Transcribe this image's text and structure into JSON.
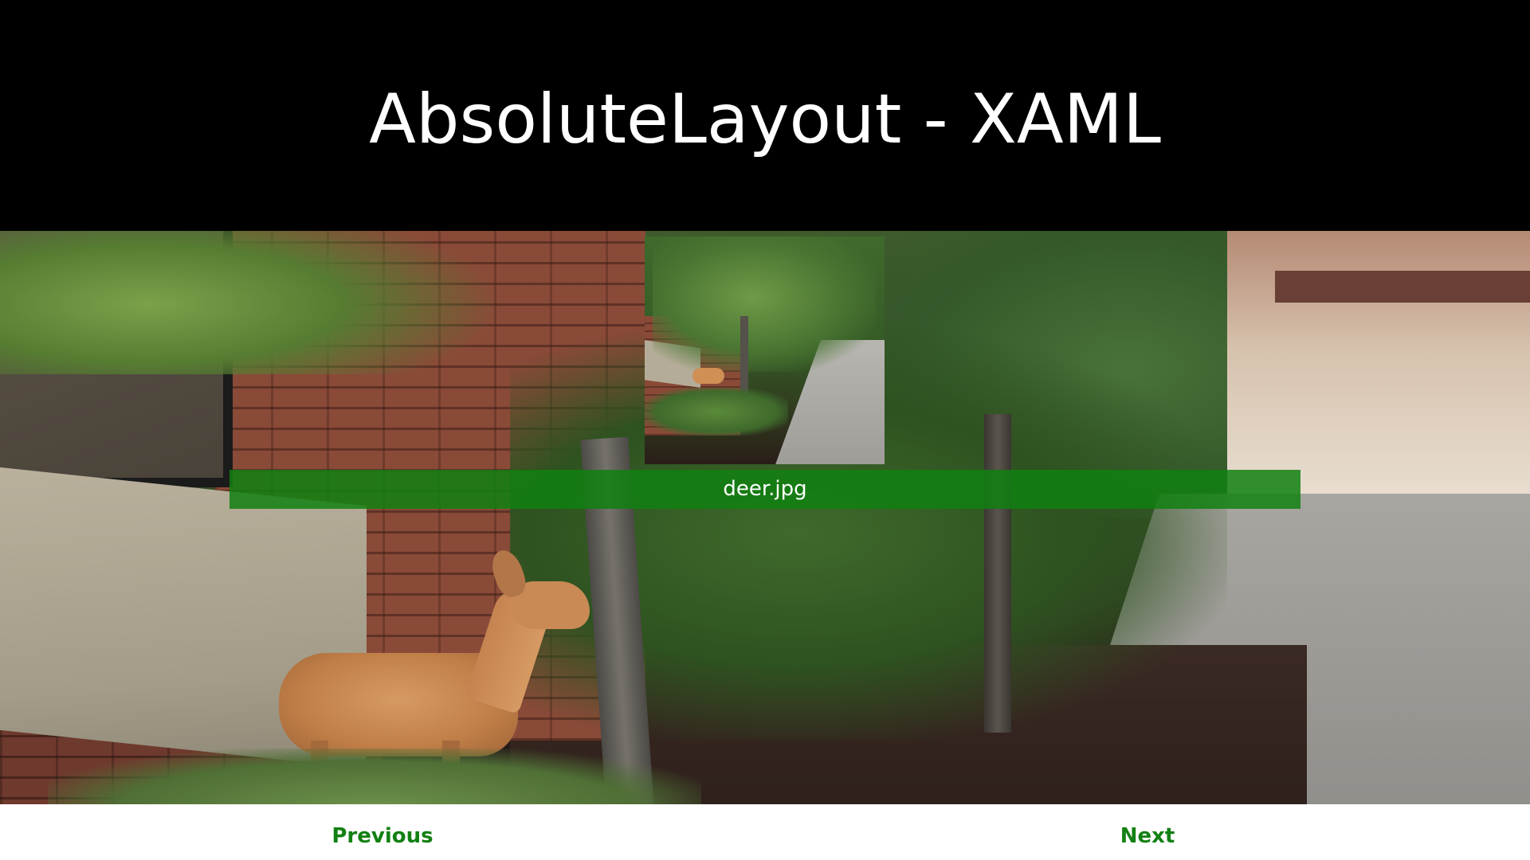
{
  "header": {
    "title": "AbsoluteLayout - XAML"
  },
  "photo": {
    "caption": "deer.jpg"
  },
  "navigation": {
    "previous_label": "Previous",
    "next_label": "Next"
  },
  "colors": {
    "header_background": "#000000",
    "title_text": "#ffffff",
    "caption_bar": "#108010",
    "nav_text": "#128012",
    "page_background": "#ffffff"
  }
}
